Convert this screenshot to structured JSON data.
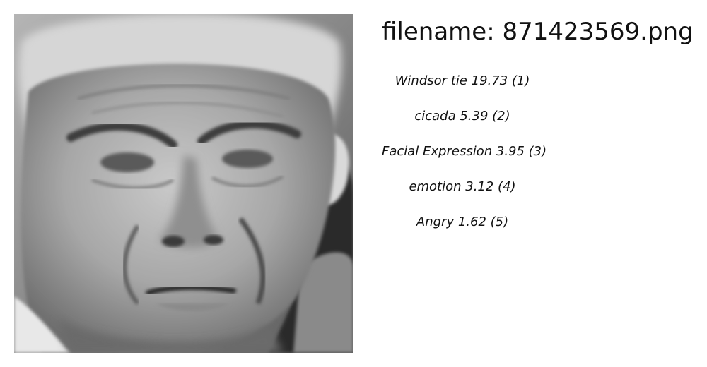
{
  "image": {
    "subject": "grayscale-face-photo"
  },
  "header": {
    "filename_text": "filename: 871423569.png"
  },
  "predictions": [
    {
      "text": "Windsor tie 19.73 (1)"
    },
    {
      "text": "cicada  5.39 (2)"
    },
    {
      "text": "Facial Expression  3.95 (3)"
    },
    {
      "text": "emotion  3.12 (4)"
    },
    {
      "text": "Angry  1.62 (5)"
    }
  ]
}
